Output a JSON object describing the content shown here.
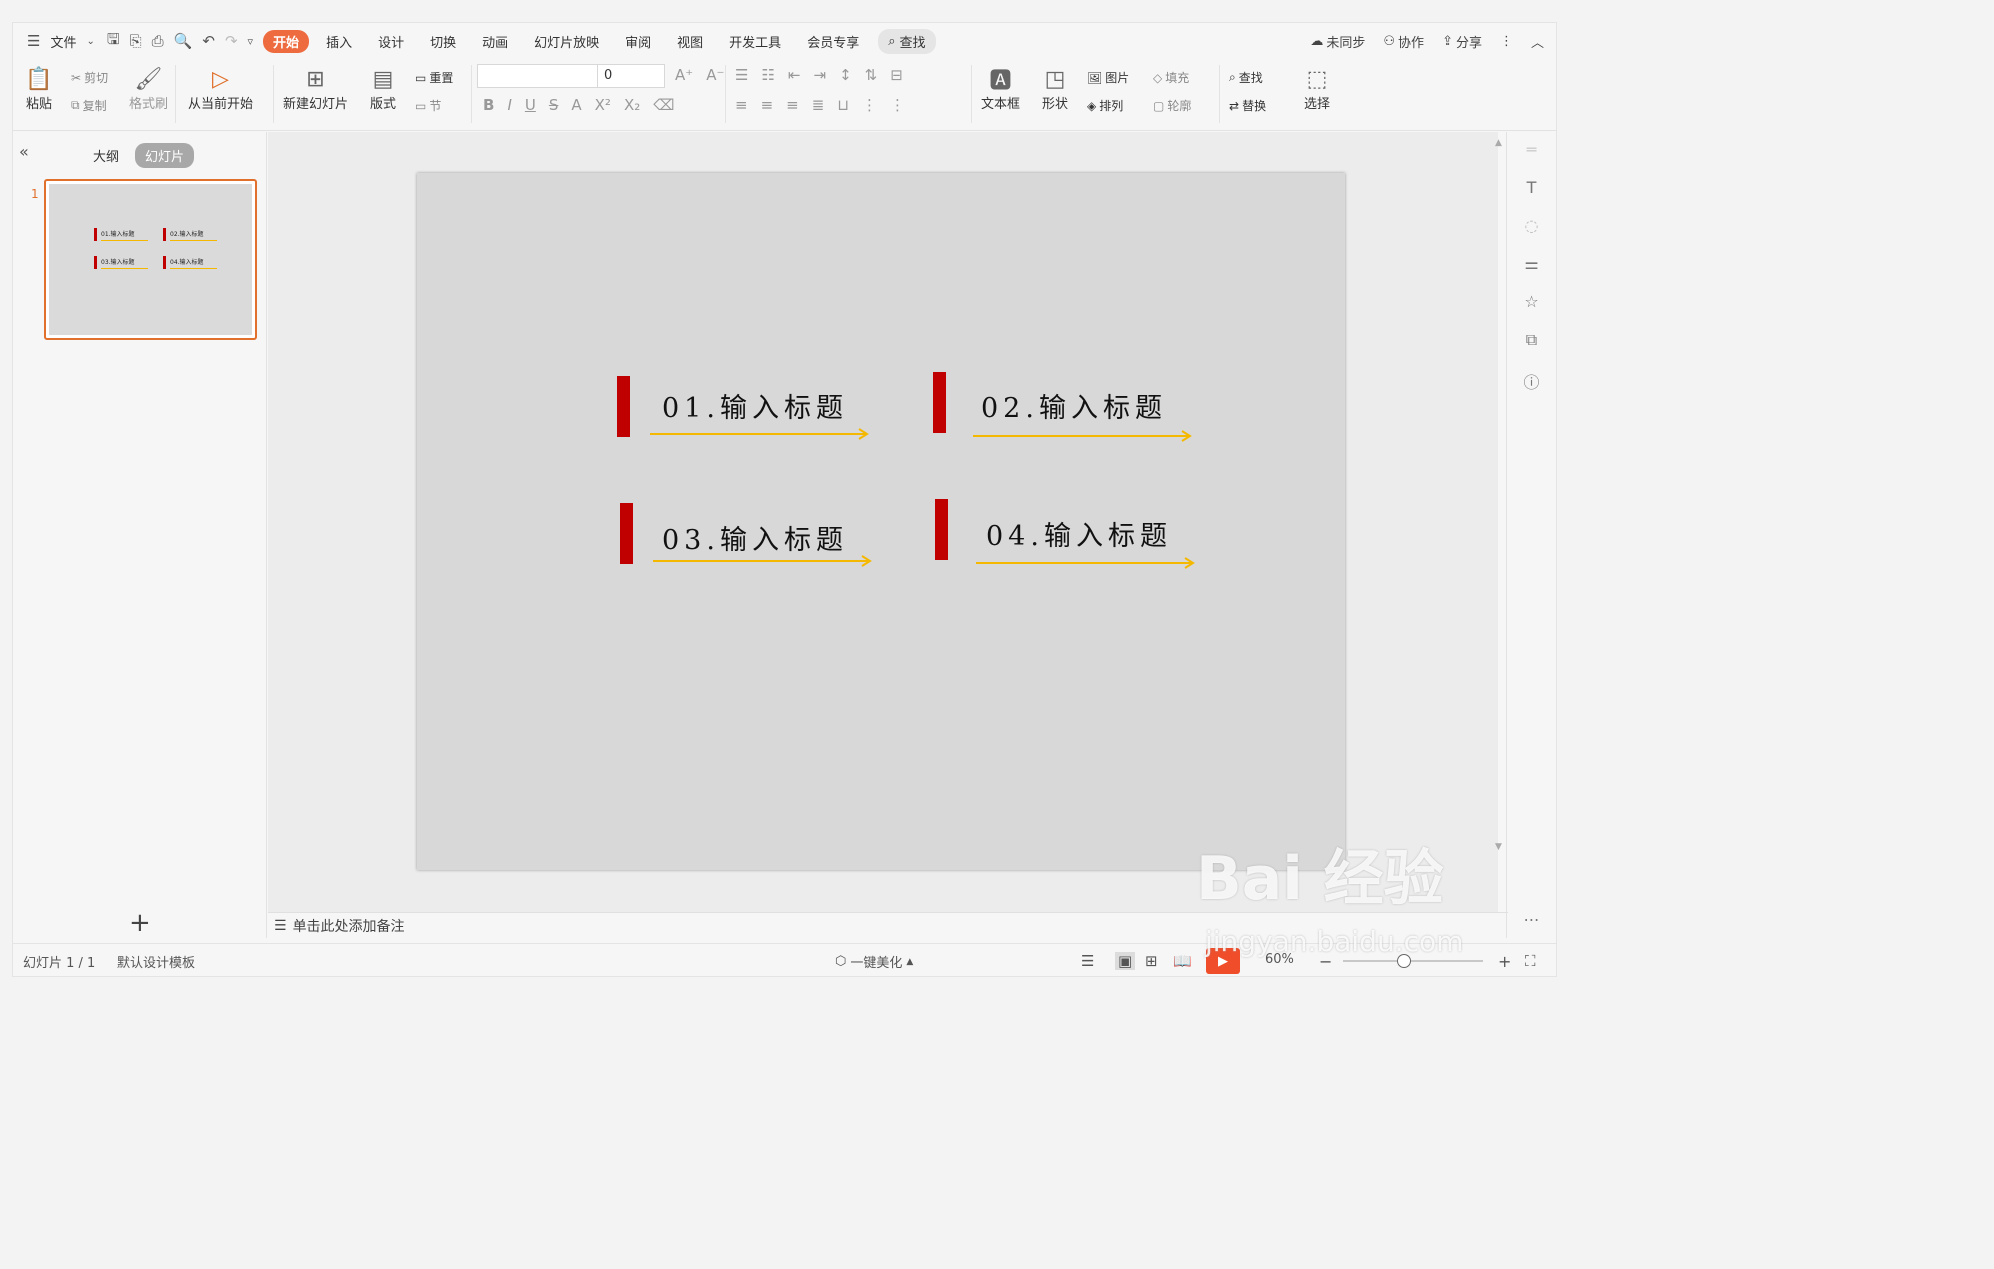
{
  "menubar": {
    "file": "文件",
    "tabs": [
      "开始",
      "插入",
      "设计",
      "切换",
      "动画",
      "幻灯片放映",
      "审阅",
      "视图",
      "开发工具",
      "会员专享"
    ],
    "active_tab": "开始",
    "search": "查找",
    "right": {
      "sync": "未同步",
      "collab": "协作",
      "share": "分享"
    }
  },
  "ribbon": {
    "paste": "粘贴",
    "cut": "剪切",
    "copy": "复制",
    "format_painter": "格式刷",
    "from_current": "从当前开始",
    "new_slide": "新建幻灯片",
    "layout": "版式",
    "reset": "重置",
    "section": "节",
    "font_name": "",
    "font_size": "0",
    "textbox": "文本框",
    "shape": "形状",
    "picture": "图片",
    "arrange": "排列",
    "fill": "填充",
    "outline": "轮廓",
    "find": "查找",
    "replace": "替换",
    "select": "选择"
  },
  "left_panel": {
    "outline_tab": "大纲",
    "slides_tab": "幻灯片",
    "slide_number": "1"
  },
  "slide": {
    "items": [
      {
        "title": "01.输入标题"
      },
      {
        "title": "02.输入标题"
      },
      {
        "title": "03.输入标题"
      },
      {
        "title": "04.输入标题"
      }
    ],
    "bar_color": "#c00000",
    "arrow_color": "#f5b800"
  },
  "notes_placeholder": "单击此处添加备注",
  "statusbar": {
    "slide_count": "幻灯片 1 / 1",
    "template": "默认设计模板",
    "beautify": "一键美化",
    "zoom": "60%"
  },
  "watermark": {
    "text": "Bai 经验",
    "url": "jingyan.baidu.com"
  }
}
